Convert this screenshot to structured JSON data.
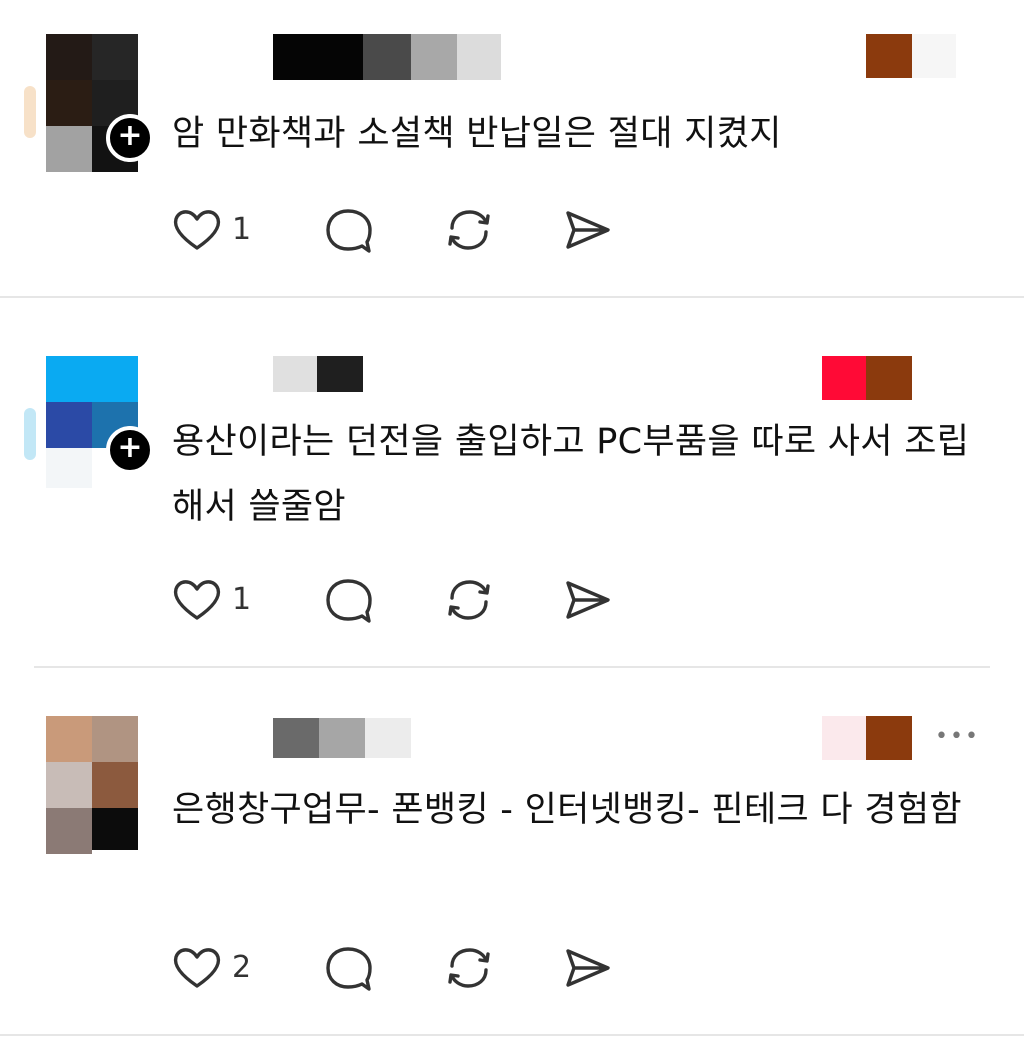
{
  "posts": [
    {
      "text": "암 만화책과 소설책 반납일은 절대 지켰지",
      "like_count": "1",
      "follow_badge": "+"
    },
    {
      "text": "용산이라는 던전을 출입하고 PC부품을 따로 사서 조립해서 쓸줄암",
      "like_count": "1",
      "follow_badge": "+"
    },
    {
      "text": "은행창구업무- 폰뱅킹 - 인터넷뱅킹- 핀테크 다 경험함",
      "like_count": "2",
      "more_label": "•••"
    }
  ],
  "icons": [
    "heart-icon",
    "comment-icon",
    "repost-icon",
    "share-icon",
    "plus-icon",
    "more-icon"
  ],
  "colors": {
    "text": "#111111",
    "icon": "#333333",
    "divider": "#e6e6e6",
    "badge": "#000000"
  }
}
